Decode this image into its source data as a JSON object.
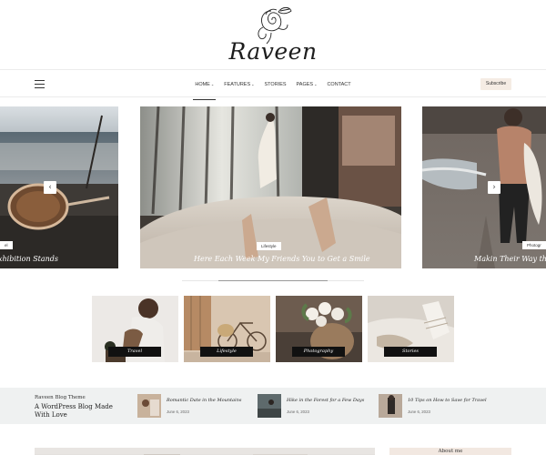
{
  "site": {
    "logo_text": "Raveen"
  },
  "nav": {
    "items": [
      {
        "label": "HOME",
        "caret": "⌄",
        "active": true
      },
      {
        "label": "FEATURES",
        "caret": "⌄"
      },
      {
        "label": "STORIES",
        "caret": ""
      },
      {
        "label": "PAGES",
        "caret": "⌄"
      },
      {
        "label": "CONTACT",
        "caret": ""
      }
    ],
    "subscribe_label": "Subscribe"
  },
  "slider": {
    "left": {
      "tag": "el",
      "title": "xhibition Stands"
    },
    "center": {
      "tag": "Lifestyle",
      "title": "Here Each Week My Friends You to Get a Smile"
    },
    "right": {
      "tag": "Photogr",
      "title": "Makin Their Way the"
    },
    "prev_icon": "‹",
    "next_icon": "›"
  },
  "categories": [
    {
      "label": "Travel"
    },
    {
      "label": "Lifestyle"
    },
    {
      "label": "Photography"
    },
    {
      "label": "Stories"
    }
  ],
  "featured": {
    "kicker": "Raveen Blog Theme",
    "heading": "A WordPress Blog Made With Love",
    "posts": [
      {
        "title": "Romantic Date in the Mountains",
        "date": "June 6, 2023"
      },
      {
        "title": "Hike in the Forest for a Few Days",
        "date": "June 6, 2023"
      },
      {
        "title": "10 Tips on How to Save for Travel",
        "date": "June 6, 2023"
      }
    ]
  },
  "sidebar": {
    "about_label": "About me"
  },
  "colors": {
    "accent": "#f5ece4",
    "strip_bg": "#eff1f1",
    "label_bg": "#111111"
  }
}
